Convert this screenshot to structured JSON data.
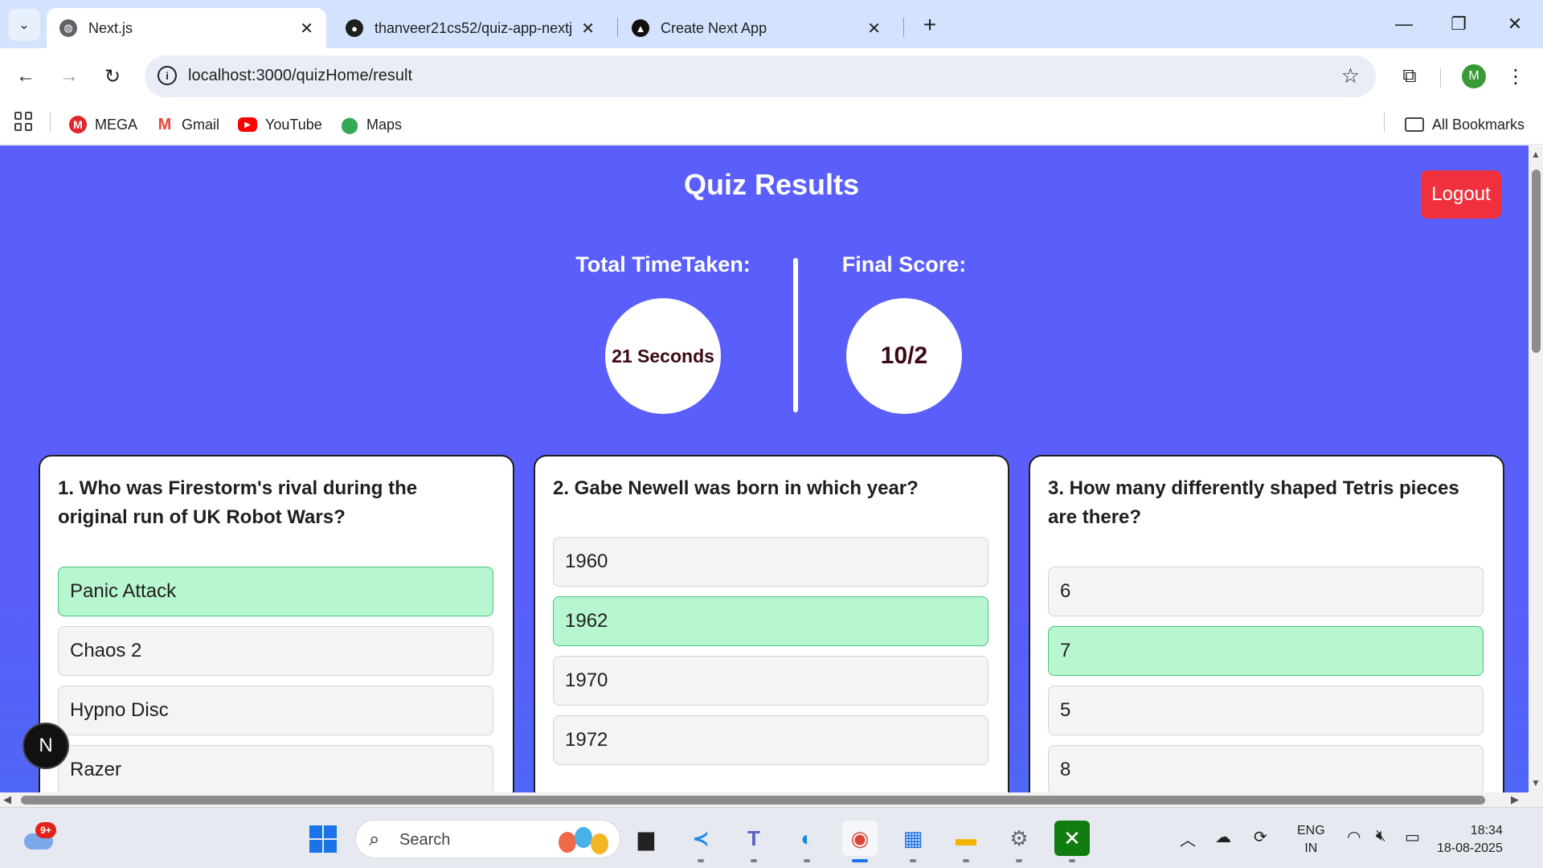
{
  "browser": {
    "tabs": [
      {
        "title": "Next.js",
        "active": true
      },
      {
        "title": "thanveer21cs52/quiz-app-nextj",
        "active": false
      },
      {
        "title": "Create Next App",
        "active": false
      }
    ],
    "url": "localhost:3000/quizHome/result",
    "profile_initial": "M",
    "bookmarks": [
      {
        "label": "MEGA",
        "icon": "mega-icon",
        "color": "#e0262b"
      },
      {
        "label": "Gmail",
        "icon": "gmail-icon",
        "color": "#ea4335"
      },
      {
        "label": "YouTube",
        "icon": "youtube-icon",
        "color": "#ff0000"
      },
      {
        "label": "Maps",
        "icon": "maps-icon",
        "color": "#34a853"
      }
    ],
    "all_bookmarks": "All Bookmarks"
  },
  "page": {
    "title": "Quiz Results",
    "logout_label": "Logout",
    "time_label": "Total TimeTaken:",
    "time_value": "21 Seconds",
    "score_label": "Final Score:",
    "score_value": "10/2",
    "questions": [
      {
        "question": "1. Who was Firestorm's rival during the original run of UK Robot Wars?",
        "options": [
          "Panic Attack",
          "Chaos 2",
          "Hypno Disc",
          "Razer"
        ],
        "correct_index": 0
      },
      {
        "question": "2. Gabe Newell was born in which year?",
        "options": [
          "1960",
          "1962",
          "1970",
          "1972"
        ],
        "correct_index": 1
      },
      {
        "question": "3. How many differently shaped Tetris pieces are there?",
        "options": [
          "6",
          "7",
          "5",
          "8"
        ],
        "correct_index": 1
      }
    ],
    "dev_badge": "N"
  },
  "taskbar": {
    "weather_badge": "9+",
    "search_placeholder": "Search",
    "lang_line1": "ENG",
    "lang_line2": "IN",
    "time": "18:34",
    "date": "18-08-2025"
  },
  "colors": {
    "page_bg": "#5a5ffc",
    "correct_bg": "#b8f6cf",
    "logout_bg": "#f0313d"
  }
}
